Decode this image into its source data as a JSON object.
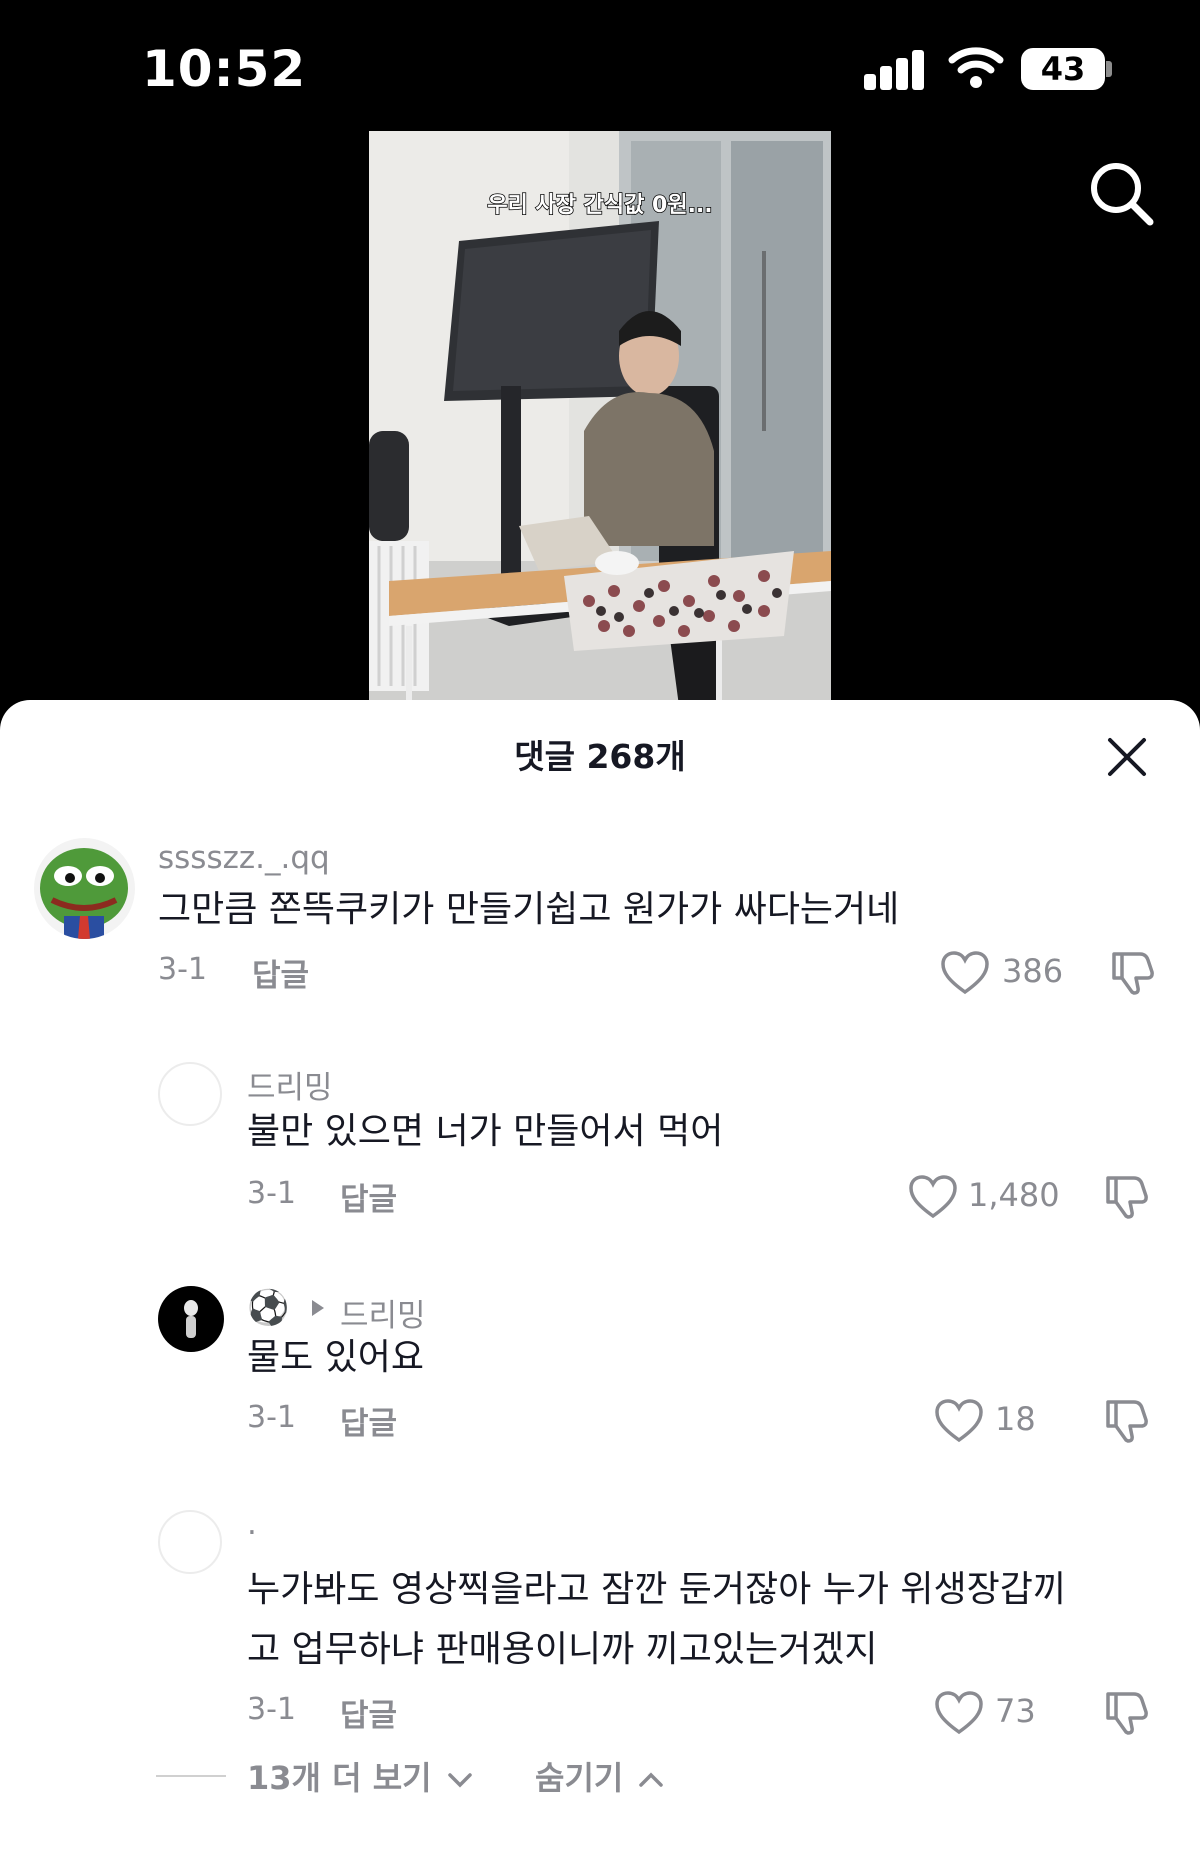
{
  "status": {
    "time": "10:52",
    "battery": "43"
  },
  "video": {
    "caption": "우리 사장 간식값 0원..."
  },
  "comments_panel": {
    "title": "댓글 268개",
    "comments": [
      {
        "username": "sssszz._.qq",
        "text": "그만큼 쫀뜩쿠키가 만들기쉽고 원가가 싸다는거네",
        "date": "3-1",
        "reply_label": "답글",
        "likes": "386"
      },
      {
        "username": "드리밍",
        "text": "불만 있으면 너가 만들어서 먹어",
        "date": "3-1",
        "reply_label": "답글",
        "likes": "1,480"
      },
      {
        "username": "⚽️",
        "reply_to": "드리밍",
        "text": "물도 있어요",
        "date": "3-1",
        "reply_label": "답글",
        "likes": "18"
      },
      {
        "username": ".",
        "text_line1": "누가봐도 영상찍을라고 잠깐 둔거잖아 누가 위생장갑끼",
        "text_line2": "고 업무하냐 판매용이니까 끼고있는거겠지",
        "date": "3-1",
        "reply_label": "답글",
        "likes": "73"
      }
    ],
    "view_more": "13개 더 보기",
    "hide": "숨기기"
  },
  "icons": {
    "search": "search-icon",
    "close": "close-icon",
    "like": "heart-icon",
    "dislike": "thumbs-down-icon",
    "reply_arrow": "caret-right-icon"
  },
  "colors": {
    "muted_text": "#8a8b91",
    "primary_text": "#161823"
  }
}
